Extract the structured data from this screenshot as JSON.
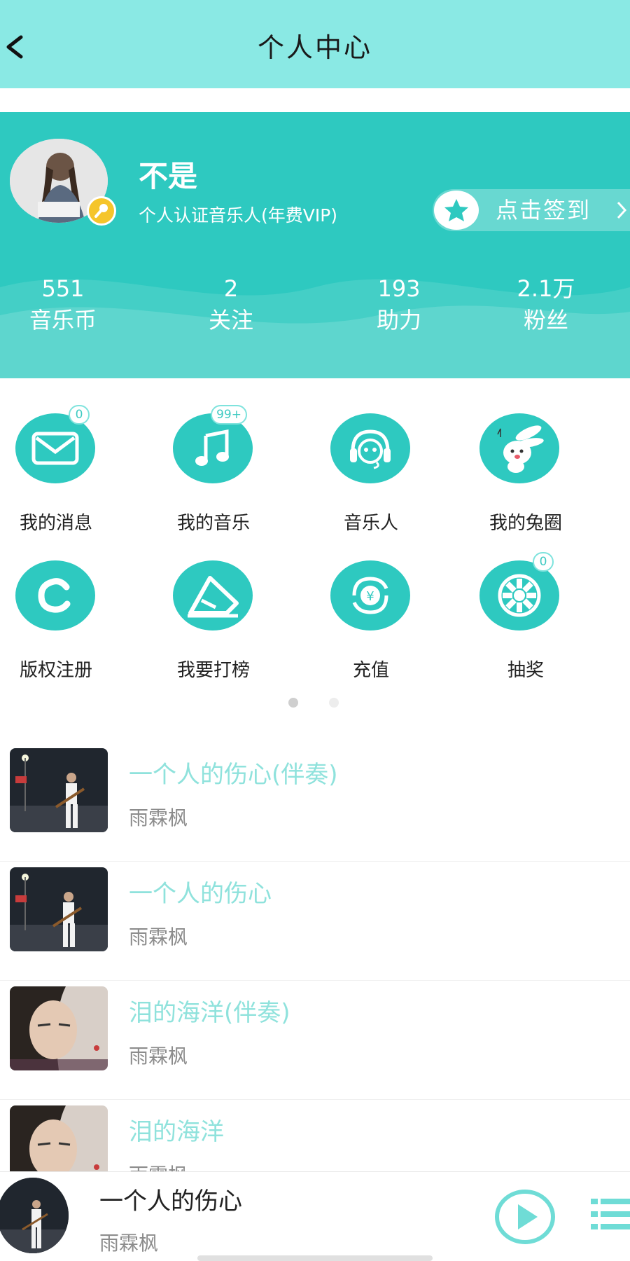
{
  "header": {
    "title": "个人中心",
    "back_icon": "chevron-left-icon"
  },
  "profile": {
    "name": "不是",
    "verification": "个人认证音乐人(年费VIP)",
    "signin_label": "点击签到",
    "stats": [
      {
        "value": "551",
        "label": "音乐币"
      },
      {
        "value": "2",
        "label": "关注"
      },
      {
        "value": "193",
        "label": "助力"
      },
      {
        "value": "2.1万",
        "label": "粉丝"
      }
    ]
  },
  "grid": {
    "row1": [
      {
        "label": "我的消息",
        "icon": "mail-icon",
        "badge": "0"
      },
      {
        "label": "我的音乐",
        "icon": "music-note-icon",
        "badge": "99+"
      },
      {
        "label": "音乐人",
        "icon": "headphones-icon",
        "badge": ""
      },
      {
        "label": "我的兔圈",
        "icon": "rabbit-icon",
        "badge": ""
      }
    ],
    "row2": [
      {
        "label": "版权注册",
        "icon": "copyright-icon",
        "badge": ""
      },
      {
        "label": "我要打榜",
        "icon": "ranking-icon",
        "badge": ""
      },
      {
        "label": "充值",
        "icon": "yuan-recharge-icon",
        "badge": ""
      },
      {
        "label": "抽奖",
        "icon": "lottery-wheel-icon",
        "badge": "0"
      }
    ],
    "page_indicator": {
      "pages": 2,
      "active": 1
    }
  },
  "songs": [
    {
      "title": "一个人的伤心(伴奏)",
      "artist": "雨霖枫"
    },
    {
      "title": "一个人的伤心",
      "artist": "雨霖枫"
    },
    {
      "title": "泪的海洋(伴奏)",
      "artist": "雨霖枫"
    },
    {
      "title": "泪的海洋",
      "artist": "雨霖枫"
    }
  ],
  "player": {
    "title": "一个人的伤心",
    "artist": "雨霖枫"
  },
  "colors": {
    "accent": "#2ec9c0",
    "header": "#8ae9e4",
    "song_title": "#8fe2dc",
    "vip": "#f5c52b"
  }
}
